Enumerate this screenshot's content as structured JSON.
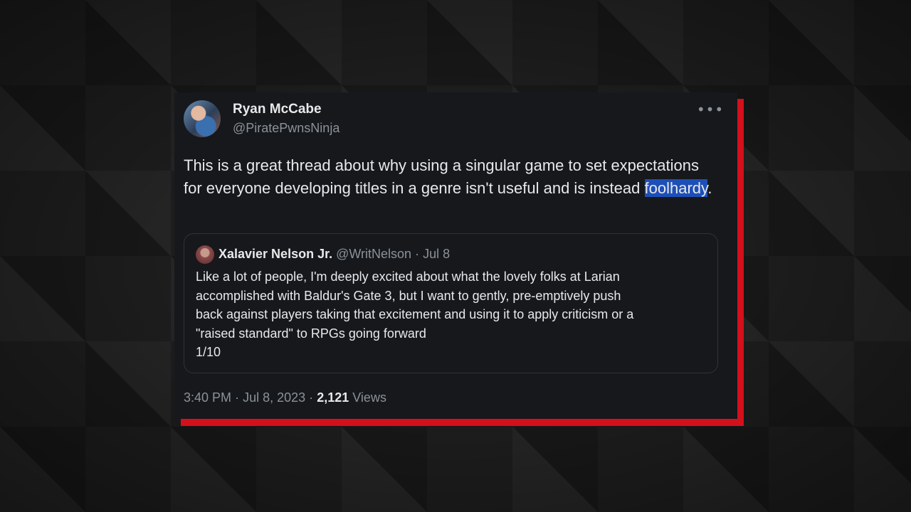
{
  "tweet": {
    "author_name": "Ryan McCabe",
    "author_handle": "@PiratePwnsNinja",
    "more_icon": "more-horizontal-icon",
    "text_before": "This is a great thread about why using a singular game to set expectations for everyone developing titles in a genre isn't useful and is instead ",
    "text_highlight": "foolhardy",
    "text_after": ".",
    "time": "3:40 PM",
    "separator": "·",
    "date": "Jul 8, 2023",
    "views_count": "2,121",
    "views_label": "Views"
  },
  "quote": {
    "author_name": "Xalavier Nelson Jr.",
    "author_handle": "@WritNelson",
    "separator": "·",
    "date": "Jul 8",
    "lines": [
      "Like a lot of people, I'm deeply excited about what the lovely folks at Larian",
      "accomplished with Baldur's Gate 3, but I want to gently, pre-emptively push",
      "back against players taking that excitement and using it to apply criticism or a",
      "\"raised standard\" to RPGs going forward",
      "1/10"
    ]
  },
  "colors": {
    "card_background": "#16181c",
    "accent_red": "#d3101c",
    "text_primary": "#e7e9ea",
    "text_secondary": "#8b9299",
    "highlight": "#1d4fb8"
  }
}
